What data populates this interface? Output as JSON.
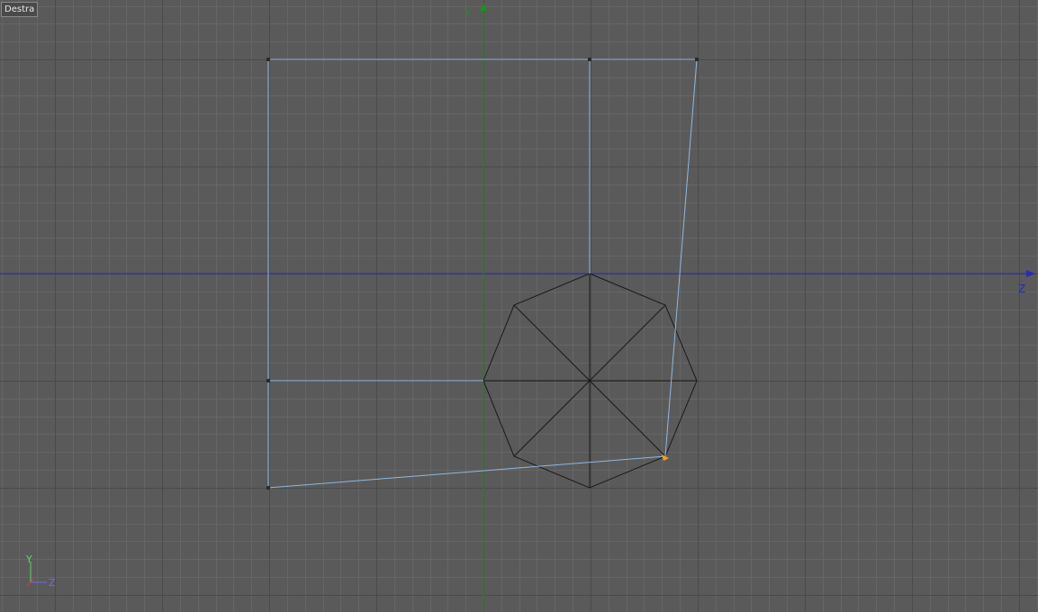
{
  "viewport": {
    "label": "Destra",
    "y_axis_label": "Y",
    "z_axis_label": "Z",
    "gizmo": {
      "y_label": "Y",
      "z_label": "Z"
    }
  },
  "colors": {
    "background": "#5a5a5a",
    "grid_minor": "#666666",
    "grid_major": "#4a4a4a",
    "y_axis": "#1f8f1f",
    "z_axis": "#2a2abf",
    "selected_edge": "#8fb8e0",
    "mesh_edge": "#1a1a1a",
    "point_handle": "#f0a020"
  }
}
